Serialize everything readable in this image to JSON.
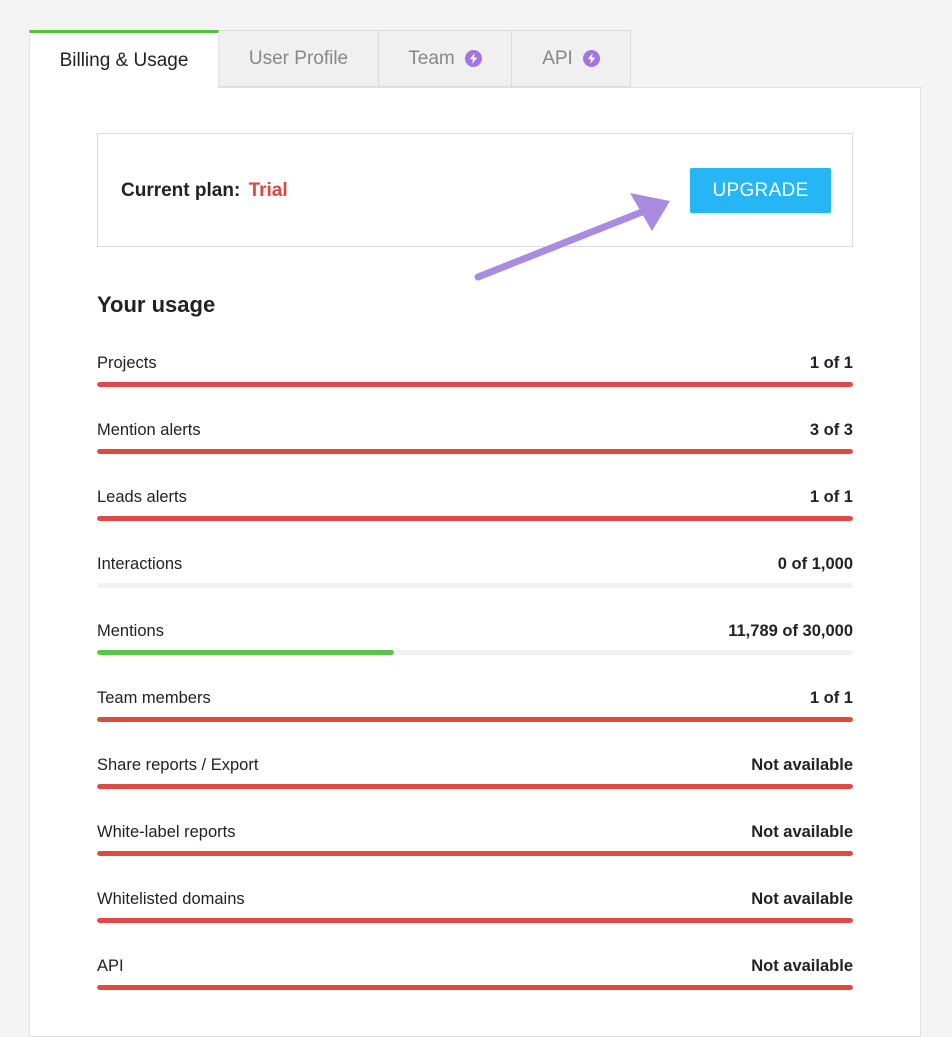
{
  "tabs": [
    {
      "label": "Billing & Usage",
      "active": true,
      "icon": null
    },
    {
      "label": "User Profile",
      "active": false,
      "icon": null
    },
    {
      "label": "Team",
      "active": false,
      "icon": "lightning-icon"
    },
    {
      "label": "API",
      "active": false,
      "icon": "lightning-icon"
    }
  ],
  "plan": {
    "label": "Current plan:",
    "value": "Trial",
    "upgrade_label": "UPGRADE"
  },
  "usage": {
    "title": "Your usage",
    "rows": [
      {
        "label": "Projects",
        "value": "1 of 1",
        "fill": 1.0,
        "color": "#e04a44"
      },
      {
        "label": "Mention alerts",
        "value": "3 of 3",
        "fill": 1.0,
        "color": "#e04a44"
      },
      {
        "label": "Leads alerts",
        "value": "1 of 1",
        "fill": 1.0,
        "color": "#e04a44"
      },
      {
        "label": "Interactions",
        "value": "0 of 1,000",
        "fill": 0.0,
        "color": "#e04a44"
      },
      {
        "label": "Mentions",
        "value": "11,789 of 30,000",
        "fill": 0.393,
        "color": "#5cc44a"
      },
      {
        "label": "Team members",
        "value": "1 of 1",
        "fill": 1.0,
        "color": "#e04a44"
      },
      {
        "label": "Share reports / Export",
        "value": "Not available",
        "fill": 1.0,
        "color": "#e04a44"
      },
      {
        "label": "White-label reports",
        "value": "Not available",
        "fill": 1.0,
        "color": "#e04a44"
      },
      {
        "label": "Whitelisted domains",
        "value": "Not available",
        "fill": 1.0,
        "color": "#e04a44"
      },
      {
        "label": "API",
        "value": "Not available",
        "fill": 1.0,
        "color": "#e04a44"
      }
    ]
  },
  "colors": {
    "accent_green": "#53c23f",
    "danger": "#e04a44",
    "upgrade_blue": "#26b6f6",
    "arrow_purple": "#a98ce0",
    "lightning_purple": "#a474e2"
  }
}
